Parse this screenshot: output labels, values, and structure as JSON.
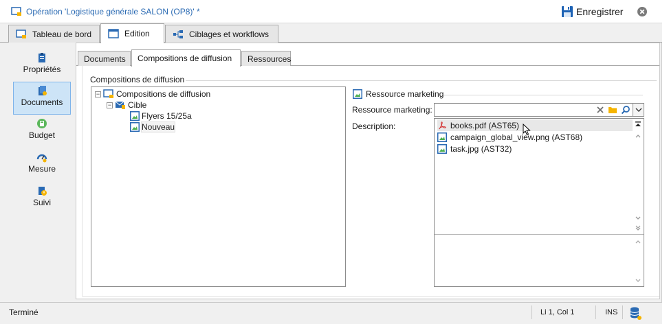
{
  "titlebar": {
    "title": "Opération 'Logistique générale SALON (OP8)' *",
    "save_label": "Enregistrer",
    "icons": {
      "app": "campaign-screen-icon",
      "save": "floppy-disk-icon",
      "close": "close-circle-icon"
    }
  },
  "main_tabs": [
    {
      "label": "Tableau de bord",
      "icon": "dashboard-icon"
    },
    {
      "label": "Edition",
      "icon": "edit-window-icon",
      "active": true
    },
    {
      "label": "Ciblages et workflows",
      "icon": "workflow-icon"
    }
  ],
  "leftnav": [
    {
      "label": "Propriétés",
      "icon": "clipboard-icon"
    },
    {
      "label": "Documents",
      "icon": "documents-icon",
      "active": true
    },
    {
      "label": "Budget",
      "icon": "calculator-icon"
    },
    {
      "label": "Mesure",
      "icon": "gauge-icon"
    },
    {
      "label": "Suivi",
      "icon": "tracking-icon"
    }
  ],
  "sub_tabs": [
    {
      "label": "Documents"
    },
    {
      "label": "Compositions de diffusion",
      "active": true
    },
    {
      "label": "Ressources"
    }
  ],
  "group_title": "Compositions de diffusion",
  "tree": {
    "root": "Compositions de diffusion",
    "cible": "Cible",
    "items": [
      "Flyers 15/25a",
      "Nouveau"
    ]
  },
  "right_panel": {
    "header": "Ressource marketing",
    "resource_label": "Ressource marketing:",
    "resource_value": "",
    "description_label": "Description:",
    "options": [
      {
        "label": "books.pdf (AST65)",
        "icon": "pdf-icon"
      },
      {
        "label": "campaign_global_view.png (AST68)",
        "icon": "image-icon"
      },
      {
        "label": "task.jpg (AST32)",
        "icon": "image-icon"
      }
    ]
  },
  "statusbar": {
    "status": "Terminé",
    "position": "Li 1, Col 1",
    "mode": "INS"
  },
  "colors": {
    "accent_blue": "#2a6ab3",
    "selection_blue": "#cde4f7",
    "asset_green": "#4caf50",
    "pdf_red": "#d32f2f"
  }
}
